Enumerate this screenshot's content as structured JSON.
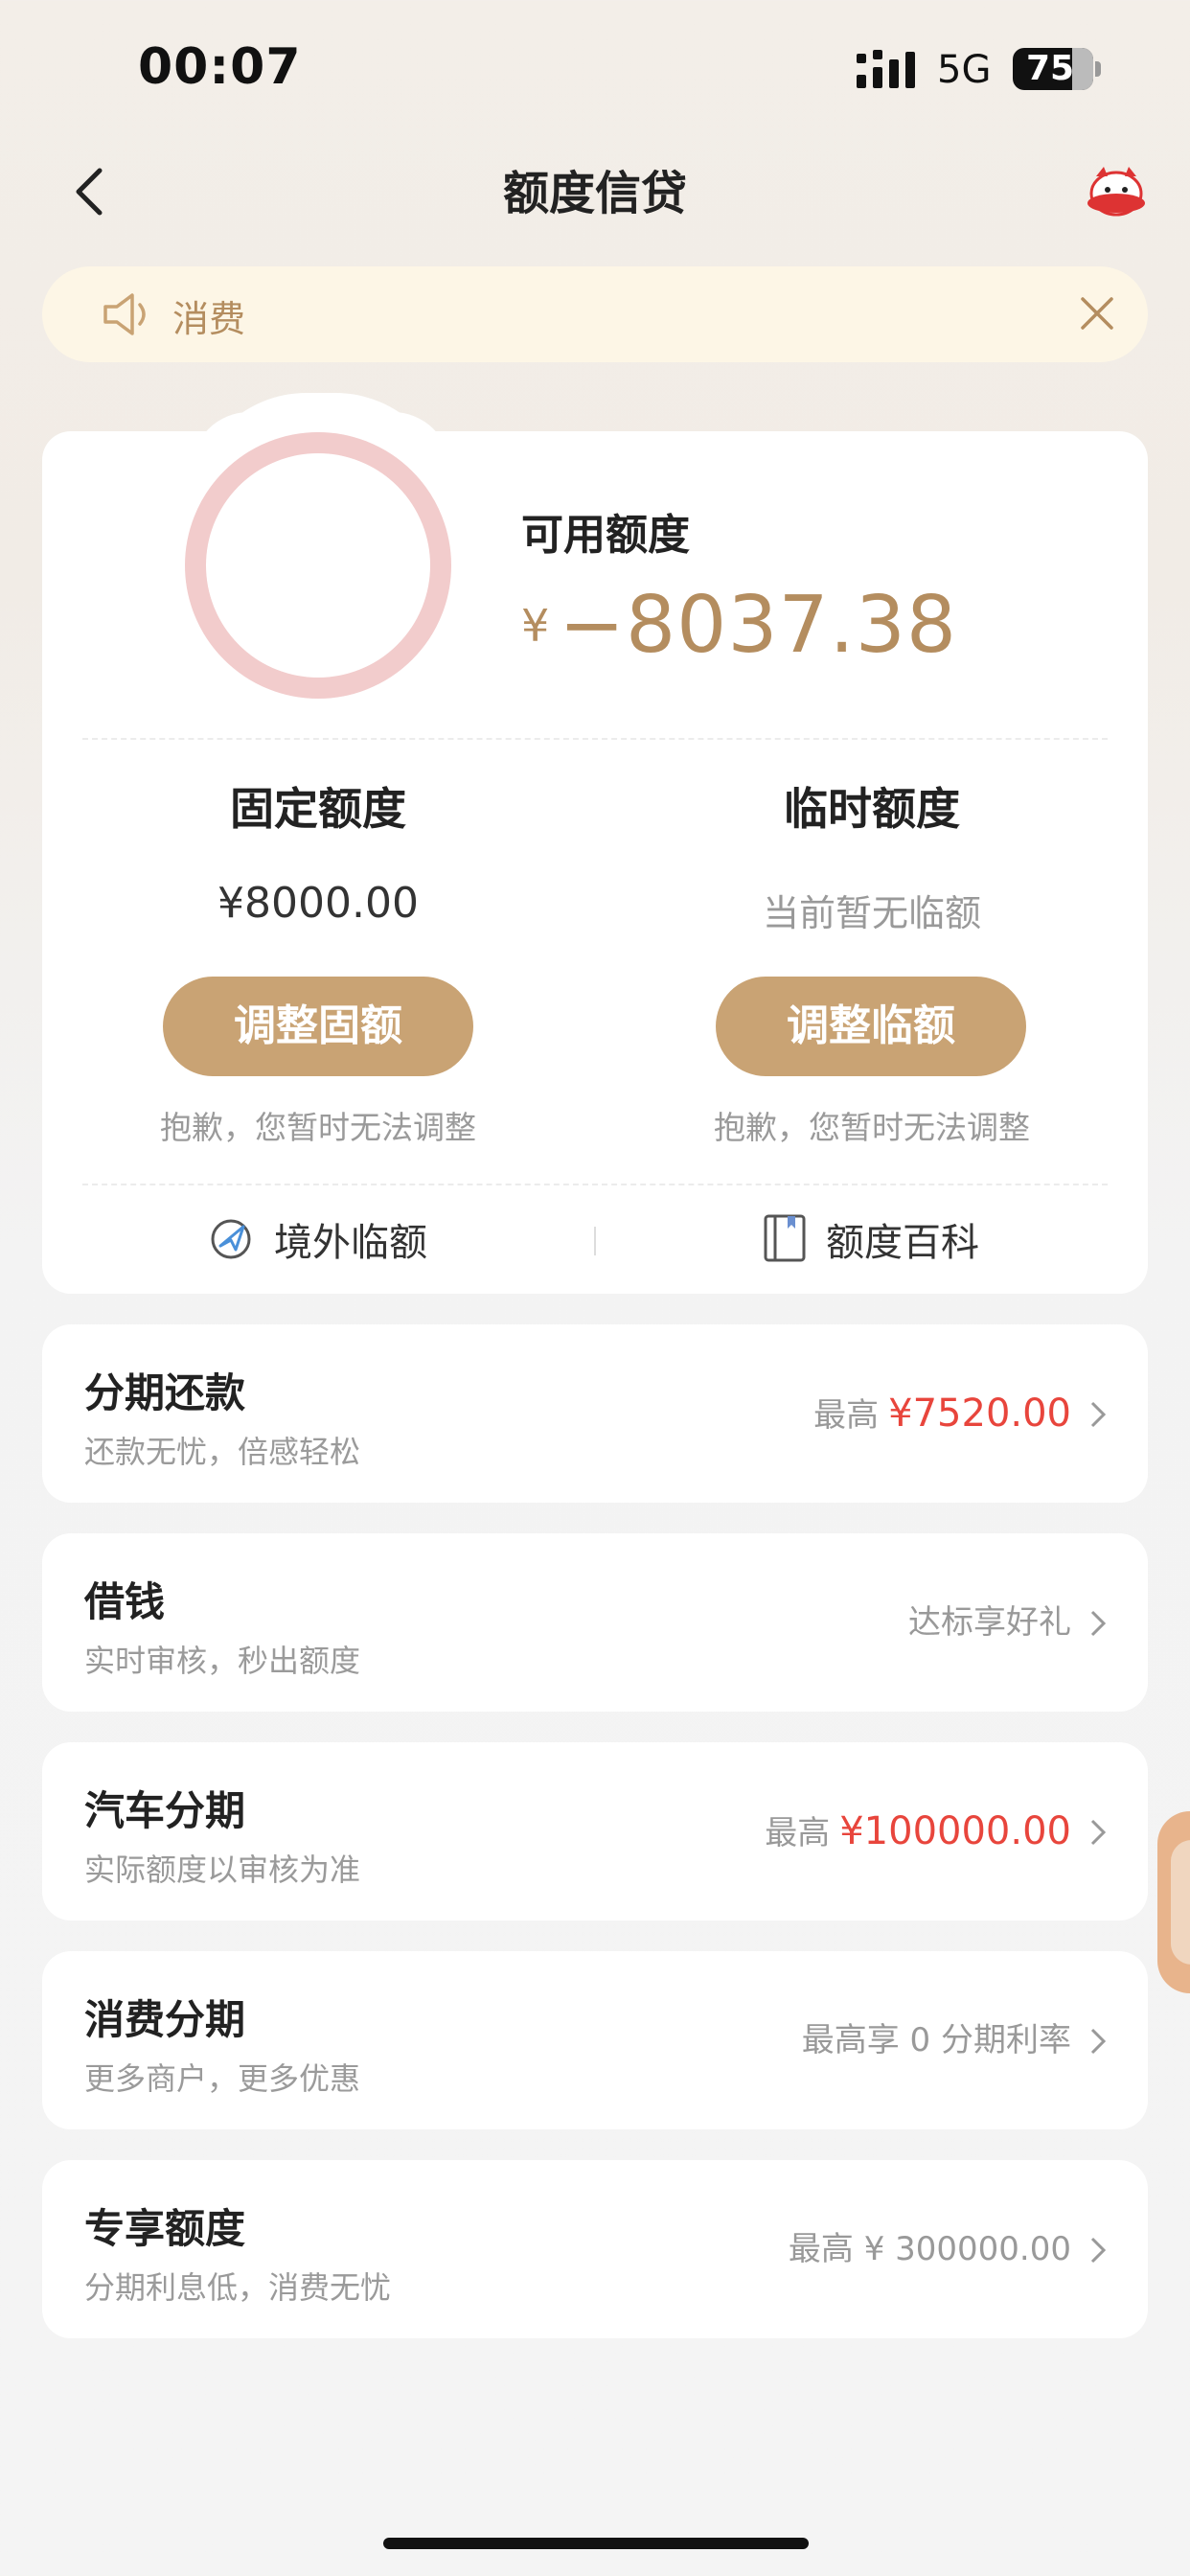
{
  "status_bar": {
    "time": "00:07",
    "network": "5G",
    "battery": "75"
  },
  "nav": {
    "title": "额度信贷",
    "back_icon": "chevron-left-icon",
    "mascot_icon": "mascot-icon"
  },
  "notice": {
    "text": "消费",
    "icon": "speaker-icon",
    "close_icon": "close-icon"
  },
  "credit": {
    "available_label": "可用额度",
    "currency_symbol": "¥",
    "available_value": "−8037.38",
    "fixed": {
      "label": "固定额度",
      "value": "¥8000.00",
      "button": "调整固额",
      "note": "抱歉，您暂时无法调整"
    },
    "temp": {
      "label": "临时额度",
      "value": "当前暂无临额",
      "button": "调整临额",
      "note": "抱歉，您暂时无法调整"
    },
    "links": [
      {
        "label": "境外临额",
        "icon": "plane-globe-icon"
      },
      {
        "label": "额度百科",
        "icon": "book-icon"
      }
    ]
  },
  "services": [
    {
      "title": "分期还款",
      "subtitle": "还款无忧，倍感轻松",
      "prefix": "最高",
      "amount": "¥7520.00"
    },
    {
      "title": "借钱",
      "subtitle": "实时审核，秒出额度",
      "prefix": "达标享好礼",
      "amount": ""
    },
    {
      "title": "汽车分期",
      "subtitle": "实际额度以审核为准",
      "prefix": "最高",
      "amount": "¥100000.00"
    },
    {
      "title": "消费分期",
      "subtitle": "更多商户，更多优惠",
      "prefix": "最高享 0 分期利率",
      "amount": ""
    },
    {
      "title": "专享额度",
      "subtitle": "分期利息低，消费无忧",
      "prefix": "最高 ¥ 300000.00",
      "amount": ""
    }
  ],
  "colors": {
    "accent": "#c9a374",
    "gold_text": "#b48d5f",
    "red": "#e8453c",
    "ring": "#f2cccc"
  }
}
